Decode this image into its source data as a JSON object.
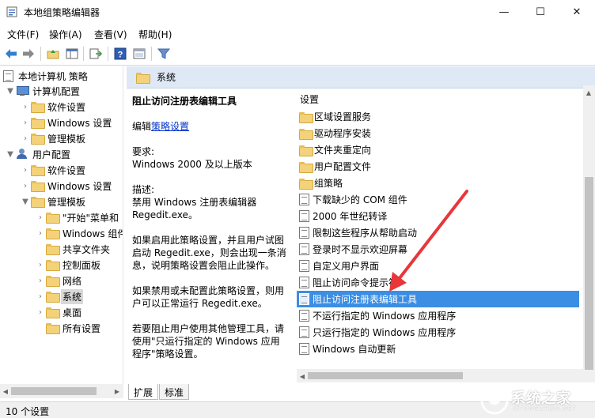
{
  "window": {
    "title": "本地组策略编辑器",
    "minimize": "—",
    "maximize": "☐",
    "close": "✕"
  },
  "menu": [
    "文件(F)",
    "操作(A)",
    "查看(V)",
    "帮助(H)"
  ],
  "toolbar_icons": [
    "back-icon",
    "forward-icon",
    "up-folder-icon",
    "show-hide-tree-icon",
    "export-list-icon",
    "help-icon",
    "properties-icon",
    "filter-icon"
  ],
  "tree": {
    "root": "本地计算机 策略",
    "computer_config": "计算机配置",
    "computer_children": [
      "软件设置",
      "Windows 设置",
      "管理模板"
    ],
    "user_config": "用户配置",
    "user_children": [
      "软件设置",
      "Windows 设置",
      "管理模板"
    ],
    "admin_templates_children": [
      "\"开始\"菜单和",
      "Windows 组件",
      "共享文件夹",
      "控制面板",
      "网络",
      "系统",
      "桌面",
      "所有设置"
    ],
    "selected": "系统"
  },
  "header": {
    "title": "系统"
  },
  "description": {
    "title": "阻止访问注册表编辑工具",
    "edit_prefix": "编辑",
    "edit_link": "策略设置",
    "requirements_label": "要求:",
    "requirements_value": "Windows 2000 及以上版本",
    "description_label": "描述:",
    "description_text": "禁用 Windows 注册表编辑器 Regedit.exe。",
    "enabled_text": "如果启用此策略设置，并且用户试图启动 Regedit.exe，则会出现一条消息，说明策略设置会阻止此操作。",
    "disabled_text": "如果禁用或未配置此策略设置，则用户可以正常运行 Regedit.exe。",
    "tip_text": "若要阻止用户使用其他管理工具，请使用\"只运行指定的 Windows 应用程序\"策略设置。"
  },
  "list": {
    "column_header": "设置",
    "folders": [
      "区域设置服务",
      "驱动程序安装",
      "文件夹重定向",
      "用户配置文件",
      "组策略"
    ],
    "settings": [
      "下载缺少的 COM 组件",
      "2000 年世纪转译",
      "限制这些程序从帮助启动",
      "登录时不显示欢迎屏幕",
      "自定义用户界面",
      "阻止访问命令提示符",
      "阻止访问注册表编辑工具",
      "不运行指定的 Windows 应用程序",
      "只运行指定的 Windows 应用程序",
      "Windows 自动更新"
    ],
    "selected": "阻止访问注册表编辑工具"
  },
  "tabs": [
    "扩展",
    "标准"
  ],
  "status": "10 个设置",
  "watermark": {
    "text": "系统之家",
    "subtext": "XITONGZHIJIA.NET"
  },
  "colors": {
    "selection": "#3b8ee3",
    "header_bg": "#dfe8f5",
    "link": "#0033cc",
    "annotation_arrow": "#e8363a"
  }
}
